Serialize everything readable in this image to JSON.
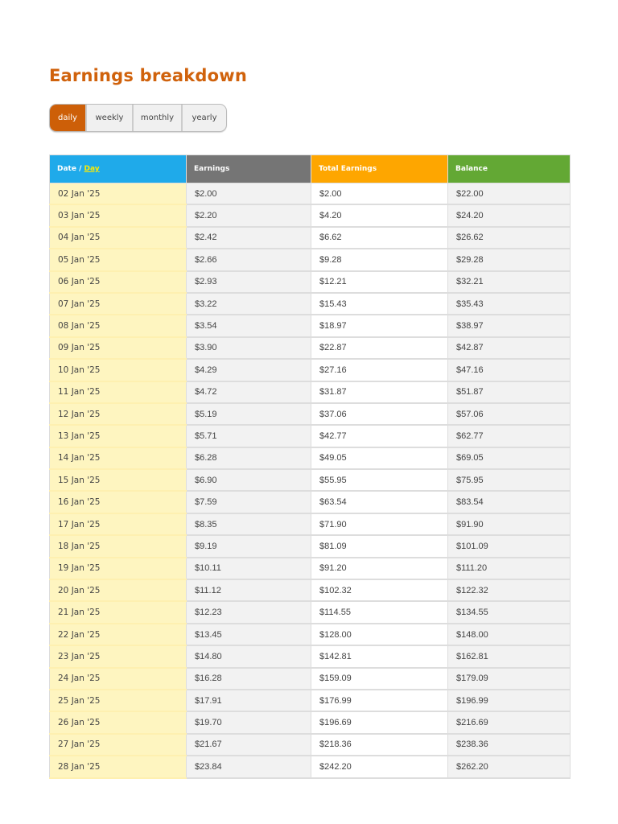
{
  "title": "Earnings breakdown",
  "tabs": [
    {
      "label": "daily",
      "active": true
    },
    {
      "label": "weekly",
      "active": false
    },
    {
      "label": "monthly",
      "active": false
    },
    {
      "label": "yearly",
      "active": false
    }
  ],
  "table": {
    "headers": {
      "date": "Date / ",
      "date_link": "Day",
      "earnings": "Earnings",
      "total": "Total Earnings",
      "balance": "Balance"
    },
    "rows": [
      [
        "02 Jan '25",
        "$2.00",
        "$2.00",
        "$22.00"
      ],
      [
        "03 Jan '25",
        "$2.20",
        "$4.20",
        "$24.20"
      ],
      [
        "04 Jan '25",
        "$2.42",
        "$6.62",
        "$26.62"
      ],
      [
        "05 Jan '25",
        "$2.66",
        "$9.28",
        "$29.28"
      ],
      [
        "06 Jan '25",
        "$2.93",
        "$12.21",
        "$32.21"
      ],
      [
        "07 Jan '25",
        "$3.22",
        "$15.43",
        "$35.43"
      ],
      [
        "08 Jan '25",
        "$3.54",
        "$18.97",
        "$38.97"
      ],
      [
        "09 Jan '25",
        "$3.90",
        "$22.87",
        "$42.87"
      ],
      [
        "10 Jan '25",
        "$4.29",
        "$27.16",
        "$47.16"
      ],
      [
        "11 Jan '25",
        "$4.72",
        "$31.87",
        "$51.87"
      ],
      [
        "12 Jan '25",
        "$5.19",
        "$37.06",
        "$57.06"
      ],
      [
        "13 Jan '25",
        "$5.71",
        "$42.77",
        "$62.77"
      ],
      [
        "14 Jan '25",
        "$6.28",
        "$49.05",
        "$69.05"
      ],
      [
        "15 Jan '25",
        "$6.90",
        "$55.95",
        "$75.95"
      ],
      [
        "16 Jan '25",
        "$7.59",
        "$63.54",
        "$83.54"
      ],
      [
        "17 Jan '25",
        "$8.35",
        "$71.90",
        "$91.90"
      ],
      [
        "18 Jan '25",
        "$9.19",
        "$81.09",
        "$101.09"
      ],
      [
        "19 Jan '25",
        "$10.11",
        "$91.20",
        "$111.20"
      ],
      [
        "20 Jan '25",
        "$11.12",
        "$102.32",
        "$122.32"
      ],
      [
        "21 Jan '25",
        "$12.23",
        "$114.55",
        "$134.55"
      ],
      [
        "22 Jan '25",
        "$13.45",
        "$128.00",
        "$148.00"
      ],
      [
        "23 Jan '25",
        "$14.80",
        "$142.81",
        "$162.81"
      ],
      [
        "24 Jan '25",
        "$16.28",
        "$159.09",
        "$179.09"
      ],
      [
        "25 Jan '25",
        "$17.91",
        "$176.99",
        "$196.99"
      ],
      [
        "26 Jan '25",
        "$19.70",
        "$196.69",
        "$216.69"
      ],
      [
        "27 Jan '25",
        "$21.67",
        "$218.36",
        "$238.36"
      ],
      [
        "28 Jan '25",
        "$23.84",
        "$242.20",
        "$262.20"
      ]
    ]
  }
}
